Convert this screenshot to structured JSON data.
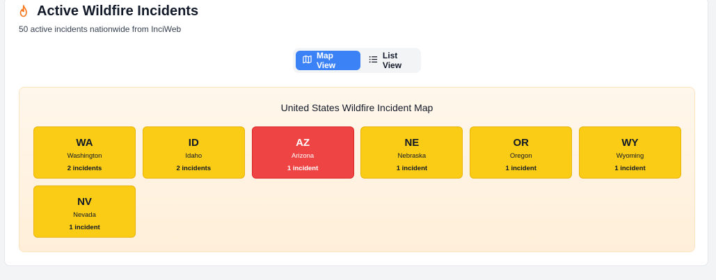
{
  "header": {
    "title": "Active Wildfire Incidents",
    "subtitle": "50 active incidents nationwide from InciWeb",
    "icon": "flame-icon",
    "icon_color": "#f97316"
  },
  "view_toggle": {
    "map_label": "Map View",
    "list_label": "List View",
    "active": "map",
    "active_color": "#3b82f6"
  },
  "map": {
    "title": "United States Wildfire Incident Map",
    "states": [
      {
        "abbr": "WA",
        "name": "Washington",
        "count": "2 incidents",
        "level": "medium"
      },
      {
        "abbr": "ID",
        "name": "Idaho",
        "count": "2 incidents",
        "level": "medium"
      },
      {
        "abbr": "AZ",
        "name": "Arizona",
        "count": "1 incident",
        "level": "high"
      },
      {
        "abbr": "NE",
        "name": "Nebraska",
        "count": "1 incident",
        "level": "medium"
      },
      {
        "abbr": "OR",
        "name": "Oregon",
        "count": "1 incident",
        "level": "medium"
      },
      {
        "abbr": "WY",
        "name": "Wyoming",
        "count": "1 incident",
        "level": "medium"
      },
      {
        "abbr": "NV",
        "name": "Nevada",
        "count": "1 incident",
        "level": "medium"
      }
    ],
    "colors": {
      "medium": "#facc15",
      "high": "#ef4444"
    }
  }
}
